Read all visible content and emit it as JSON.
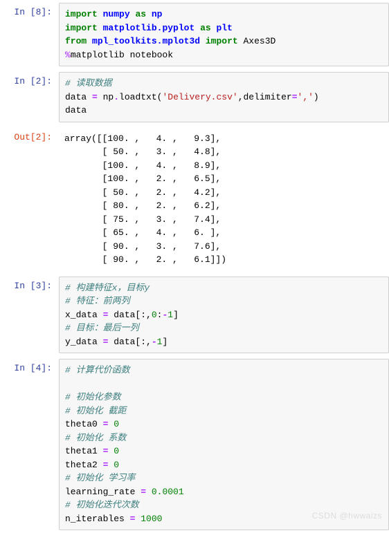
{
  "watermark": "CSDN @hwwaizs",
  "cells": [
    {
      "prompt": "In  [8]:",
      "ptype": "in",
      "kind": "code",
      "tokens": [
        {
          "c": "kw",
          "t": "import"
        },
        {
          "t": " "
        },
        {
          "c": "nn",
          "t": "numpy"
        },
        {
          "t": " "
        },
        {
          "c": "kw",
          "t": "as"
        },
        {
          "t": " "
        },
        {
          "c": "nn",
          "t": "np"
        },
        {
          "t": "\n"
        },
        {
          "c": "kw",
          "t": "import"
        },
        {
          "t": " "
        },
        {
          "c": "nn",
          "t": "matplotlib.pyplot"
        },
        {
          "t": " "
        },
        {
          "c": "kw",
          "t": "as"
        },
        {
          "t": " "
        },
        {
          "c": "nn",
          "t": "plt"
        },
        {
          "t": "\n"
        },
        {
          "c": "kw",
          "t": "from"
        },
        {
          "t": " "
        },
        {
          "c": "nn",
          "t": "mpl_toolkits.mplot3d"
        },
        {
          "t": " "
        },
        {
          "c": "kw",
          "t": "import"
        },
        {
          "t": " Axes3D\n"
        },
        {
          "c": "mag",
          "t": "%"
        },
        {
          "t": "matplotlib notebook"
        }
      ]
    },
    {
      "prompt": "In  [2]:",
      "ptype": "in",
      "kind": "code",
      "tokens": [
        {
          "c": "cm",
          "t": "# 读取数据"
        },
        {
          "t": "\n"
        },
        {
          "t": "data "
        },
        {
          "c": "op",
          "t": "="
        },
        {
          "t": " np"
        },
        {
          "c": "op",
          "t": "."
        },
        {
          "t": "loadtxt("
        },
        {
          "c": "str",
          "t": "'Delivery.csv'"
        },
        {
          "t": ",delimiter"
        },
        {
          "c": "op",
          "t": "="
        },
        {
          "c": "str",
          "t": "','"
        },
        {
          "t": ")\n"
        },
        {
          "t": "data"
        }
      ]
    },
    {
      "prompt": "Out[2]:",
      "ptype": "out",
      "kind": "output",
      "text": "array([[100. ,   4. ,   9.3],\n       [ 50. ,   3. ,   4.8],\n       [100. ,   4. ,   8.9],\n       [100. ,   2. ,   6.5],\n       [ 50. ,   2. ,   4.2],\n       [ 80. ,   2. ,   6.2],\n       [ 75. ,   3. ,   7.4],\n       [ 65. ,   4. ,   6. ],\n       [ 90. ,   3. ,   7.6],\n       [ 90. ,   2. ,   6.1]])"
    },
    {
      "prompt": "In  [3]:",
      "ptype": "in",
      "kind": "code",
      "tokens": [
        {
          "c": "cm",
          "t": "# 构建特征x，目标y"
        },
        {
          "t": "\n"
        },
        {
          "c": "cm",
          "t": "# 特征：前两列"
        },
        {
          "t": "\n"
        },
        {
          "t": "x_data "
        },
        {
          "c": "op",
          "t": "="
        },
        {
          "t": " data[:,"
        },
        {
          "c": "num",
          "t": "0"
        },
        {
          "t": ":"
        },
        {
          "c": "op",
          "t": "-"
        },
        {
          "c": "num",
          "t": "1"
        },
        {
          "t": "]\n"
        },
        {
          "c": "cm",
          "t": "# 目标：最后一列"
        },
        {
          "t": "\n"
        },
        {
          "t": "y_data "
        },
        {
          "c": "op",
          "t": "="
        },
        {
          "t": " data[:,"
        },
        {
          "c": "op",
          "t": "-"
        },
        {
          "c": "num",
          "t": "1"
        },
        {
          "t": "]"
        }
      ]
    },
    {
      "prompt": "In  [4]:",
      "ptype": "in",
      "kind": "code",
      "tokens": [
        {
          "c": "cm",
          "t": "# 计算代价函数"
        },
        {
          "t": "\n\n"
        },
        {
          "c": "cm",
          "t": "# 初始化参数"
        },
        {
          "t": "\n"
        },
        {
          "c": "cm",
          "t": "# 初始化 截距"
        },
        {
          "t": "\n"
        },
        {
          "t": "theta0 "
        },
        {
          "c": "op",
          "t": "="
        },
        {
          "t": " "
        },
        {
          "c": "num",
          "t": "0"
        },
        {
          "t": "\n"
        },
        {
          "c": "cm",
          "t": "# 初始化 系数"
        },
        {
          "t": "\n"
        },
        {
          "t": "theta1 "
        },
        {
          "c": "op",
          "t": "="
        },
        {
          "t": " "
        },
        {
          "c": "num",
          "t": "0"
        },
        {
          "t": "\n"
        },
        {
          "t": "theta2 "
        },
        {
          "c": "op",
          "t": "="
        },
        {
          "t": " "
        },
        {
          "c": "num",
          "t": "0"
        },
        {
          "t": "\n"
        },
        {
          "c": "cm",
          "t": "# 初始化 学习率"
        },
        {
          "t": "\n"
        },
        {
          "t": "learning_rate "
        },
        {
          "c": "op",
          "t": "="
        },
        {
          "t": " "
        },
        {
          "c": "num",
          "t": "0.0001"
        },
        {
          "t": "\n"
        },
        {
          "c": "cm",
          "t": "# 初始化迭代次数"
        },
        {
          "t": "\n"
        },
        {
          "t": "n_iterables "
        },
        {
          "c": "op",
          "t": "="
        },
        {
          "t": " "
        },
        {
          "c": "num",
          "t": "1000"
        }
      ]
    }
  ]
}
